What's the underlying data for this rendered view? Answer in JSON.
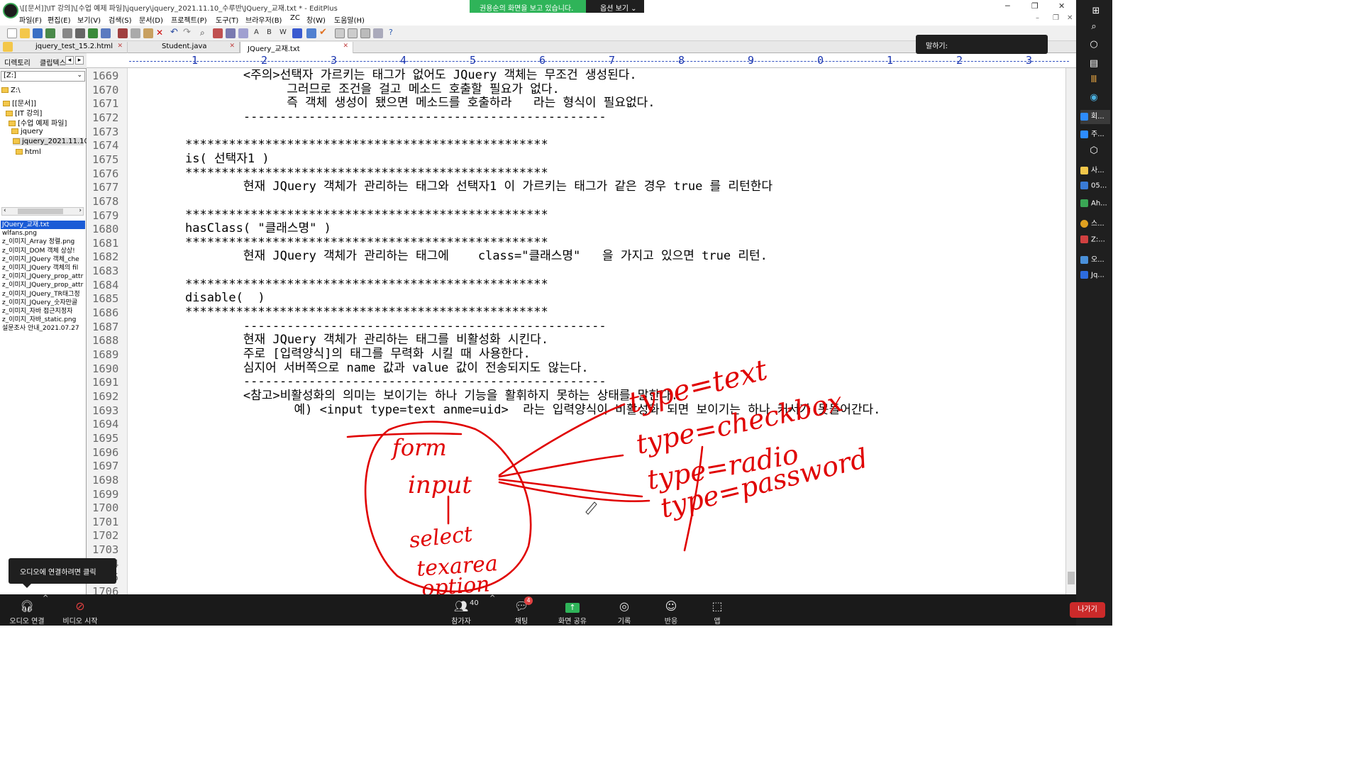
{
  "window": {
    "title": "\\[[문서]]\\IT 강의]\\[수업 예제 파일]\\jquery\\jquery_2021.11.10_수루반\\JQuery_교재.txt * - EditPlus",
    "share_banner": "권용순의 화면을 보고 있습니다.",
    "share_options": "옵션 보기 ⌄"
  },
  "menu": [
    "파일(F)",
    "편집(E)",
    "보기(V)",
    "검색(S)",
    "문서(D)",
    "프로젝트(P)",
    "도구(T)",
    "브라우저(B)",
    "ZC",
    "창(W)",
    "도움말(H)"
  ],
  "tabs": [
    {
      "label": "jquery_test_15.2.html"
    },
    {
      "label": "Student.java"
    },
    {
      "label": "JQuery_교재.txt"
    }
  ],
  "talk_label": "말하기:",
  "sidebar": {
    "tabs": [
      "디렉토리",
      "클립텍스"
    ],
    "drive": "[Z:]",
    "tree": [
      "Z:\\",
      "[[문서]]",
      "[IT 강의]",
      "[수업 예제 파일]",
      "jquery",
      "jquery_2021.11.10_",
      "html"
    ],
    "files": [
      "JQuery_교재.txt",
      "wlfans.png",
      "z_이미지_Array 정렬.png",
      "z_이미지_DOM 객체 상상!",
      "z_이미지_JQuery 객체_che",
      "z_이미지_JQuery 객체의 fil",
      "z_이미지_JQuery_prop_attr",
      "z_이미지_JQuery_prop_attr",
      "z_이미지_JQuery_TR태그정",
      "z_이미지_JQuery_숫자만골",
      "z_이미지_자바 접근지정자",
      "z_이미지_자바_static.png",
      "설문조사 안내_2021.07.27"
    ]
  },
  "ruler": [
    "1",
    "2",
    "3",
    "4",
    "5",
    "6",
    "7",
    "8",
    "9",
    "0",
    "1",
    "2",
    "3"
  ],
  "line_numbers": [
    "1669",
    "1670",
    "1671",
    "1672",
    "1673",
    "1674",
    "1675",
    "1676",
    "1677",
    "1678",
    "1679",
    "1680",
    "1681",
    "1682",
    "1683",
    "1684",
    "1685",
    "1686",
    "1687",
    "1688",
    "1689",
    "1690",
    "1691",
    "1692",
    "1693",
    "1694",
    "1695",
    "1696",
    "1697",
    "1698",
    "1699",
    "1700",
    "1701",
    "1702",
    "1703",
    "1704",
    "1705",
    "1706"
  ],
  "code_lines": [
    "        <주의>선택자 가르키는 태그가 없어도 JQuery 객체는 무조건 생성된다.",
    "              그러므로 조건을 걸고 메소드 호출할 필요가 없다.",
    "              즉 객체 생성이 됐으면 메소드를 호출하라   라는 형식이 필요없다.",
    "        --------------------------------------------------",
    "",
    "**************************************************",
    "is( 선택자1 )",
    "**************************************************",
    "        현재 JQuery 객체가 관리하는 태그와 선택자1 이 가르키는 태그가 같은 경우 true 를 리턴한다",
    "",
    "**************************************************",
    "hasClass( \"클래스명\" )",
    "**************************************************",
    "        현재 JQuery 객체가 관리하는 태그에    class=\"클래스명\"   을 가지고 있으면 true 리턴.",
    "",
    "**************************************************",
    "disable(  )",
    "**************************************************",
    "        --------------------------------------------------",
    "        현재 JQuery 객체가 관리하는 태그를 비활성화 시킨다.",
    "        주로 [입력양식]의 태그를 무력화 시킬 때 사용한다.",
    "        심지어 서버쪽으로 name 값과 value 값이 전송되지도 않는다.",
    "        --------------------------------------------------",
    "        <참고>비활성화의 의미는 보이기는 하나 기능을 활휘하지 못하는 상태를 말한다.",
    "               예) <input type=text anme=uid>  라는 입력양식이 비활성화 되면 보이기는 하나 커서가 못들어간다.",
    "",
    "",
    "",
    "",
    "",
    "",
    "",
    "",
    "",
    "",
    "",
    "",
    ""
  ],
  "handwriting": [
    "form",
    "input",
    "select",
    "texarea",
    "option",
    "type=text",
    "type=checkbox",
    "type=radio",
    "type=password"
  ],
  "right_rail": [
    {
      "label": "회...",
      "color": "#2d8cff"
    },
    {
      "label": "주...",
      "color": "#2d8cff"
    },
    {
      "label": "사...",
      "color": "#f3c74a"
    },
    {
      "label": "05...",
      "color": "#3a7bd5"
    },
    {
      "label": "Ah...",
      "color": "#3aa655"
    },
    {
      "label": "스...",
      "color": "#e0a020"
    },
    {
      "label": "Z:...",
      "color": "#d04040"
    },
    {
      "label": "오...",
      "color": "#4a90d9"
    },
    {
      "label": "Jq...",
      "color": "#2d6cdf"
    }
  ],
  "audio_tip": "오디오에 연결하려면 클릭",
  "zoom": {
    "audio": "오디오 연결",
    "video": "비디오 시작",
    "participants": "참가자",
    "participant_count": "40",
    "chat": "채팅",
    "chat_badge": "4",
    "share": "화면 공유",
    "record": "기록",
    "reactions": "반응",
    "apps": "앱",
    "leave": "나가기"
  },
  "colors": {
    "share_green": "#2fb459",
    "ruler_blue": "#1a35b0",
    "ink_red": "#e00000",
    "selection_blue": "#1a5bd6",
    "leave_red": "#cc2a2a"
  }
}
